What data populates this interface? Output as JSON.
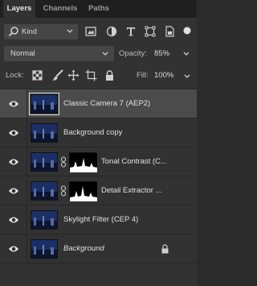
{
  "tabs": [
    {
      "label": "Layers",
      "active": true
    },
    {
      "label": "Channels",
      "active": false
    },
    {
      "label": "Paths",
      "active": false
    }
  ],
  "filter": {
    "kind_label": "Kind",
    "icons": [
      "pixel-filter-icon",
      "adjustment-filter-icon",
      "type-filter-icon",
      "shape-filter-icon",
      "smart-object-filter-icon"
    ],
    "toggle": "filter-toggle-icon"
  },
  "blend": {
    "mode": "Normal",
    "opacity_label": "Opacity:",
    "opacity_value": "85%"
  },
  "lock": {
    "label": "Lock:",
    "icons": [
      "lock-transparent-icon",
      "lock-image-icon",
      "lock-position-icon",
      "lock-artboard-icon",
      "lock-all-icon"
    ],
    "fill_label": "Fill:",
    "fill_value": "100%"
  },
  "layers": [
    {
      "name": "Classic Camera 7 (AEP2)",
      "selected": true,
      "has_mask": false,
      "locked": false,
      "italic": false
    },
    {
      "name": "Background copy",
      "selected": false,
      "has_mask": false,
      "locked": false,
      "italic": false
    },
    {
      "name": "Tonal Contrast (C...",
      "selected": false,
      "has_mask": true,
      "locked": false,
      "italic": false
    },
    {
      "name": "Detail Extractor ...",
      "selected": false,
      "has_mask": true,
      "locked": false,
      "italic": false
    },
    {
      "name": "Skylight Filter (CEP 4)",
      "selected": false,
      "has_mask": false,
      "locked": false,
      "italic": false
    },
    {
      "name": "Background",
      "selected": false,
      "has_mask": false,
      "locked": true,
      "italic": true
    }
  ],
  "colors": {
    "panel": "#323232",
    "selected_row": "#4b4b4b",
    "tab_bar": "#1f1f1f",
    "text": "#e0e0e0"
  }
}
